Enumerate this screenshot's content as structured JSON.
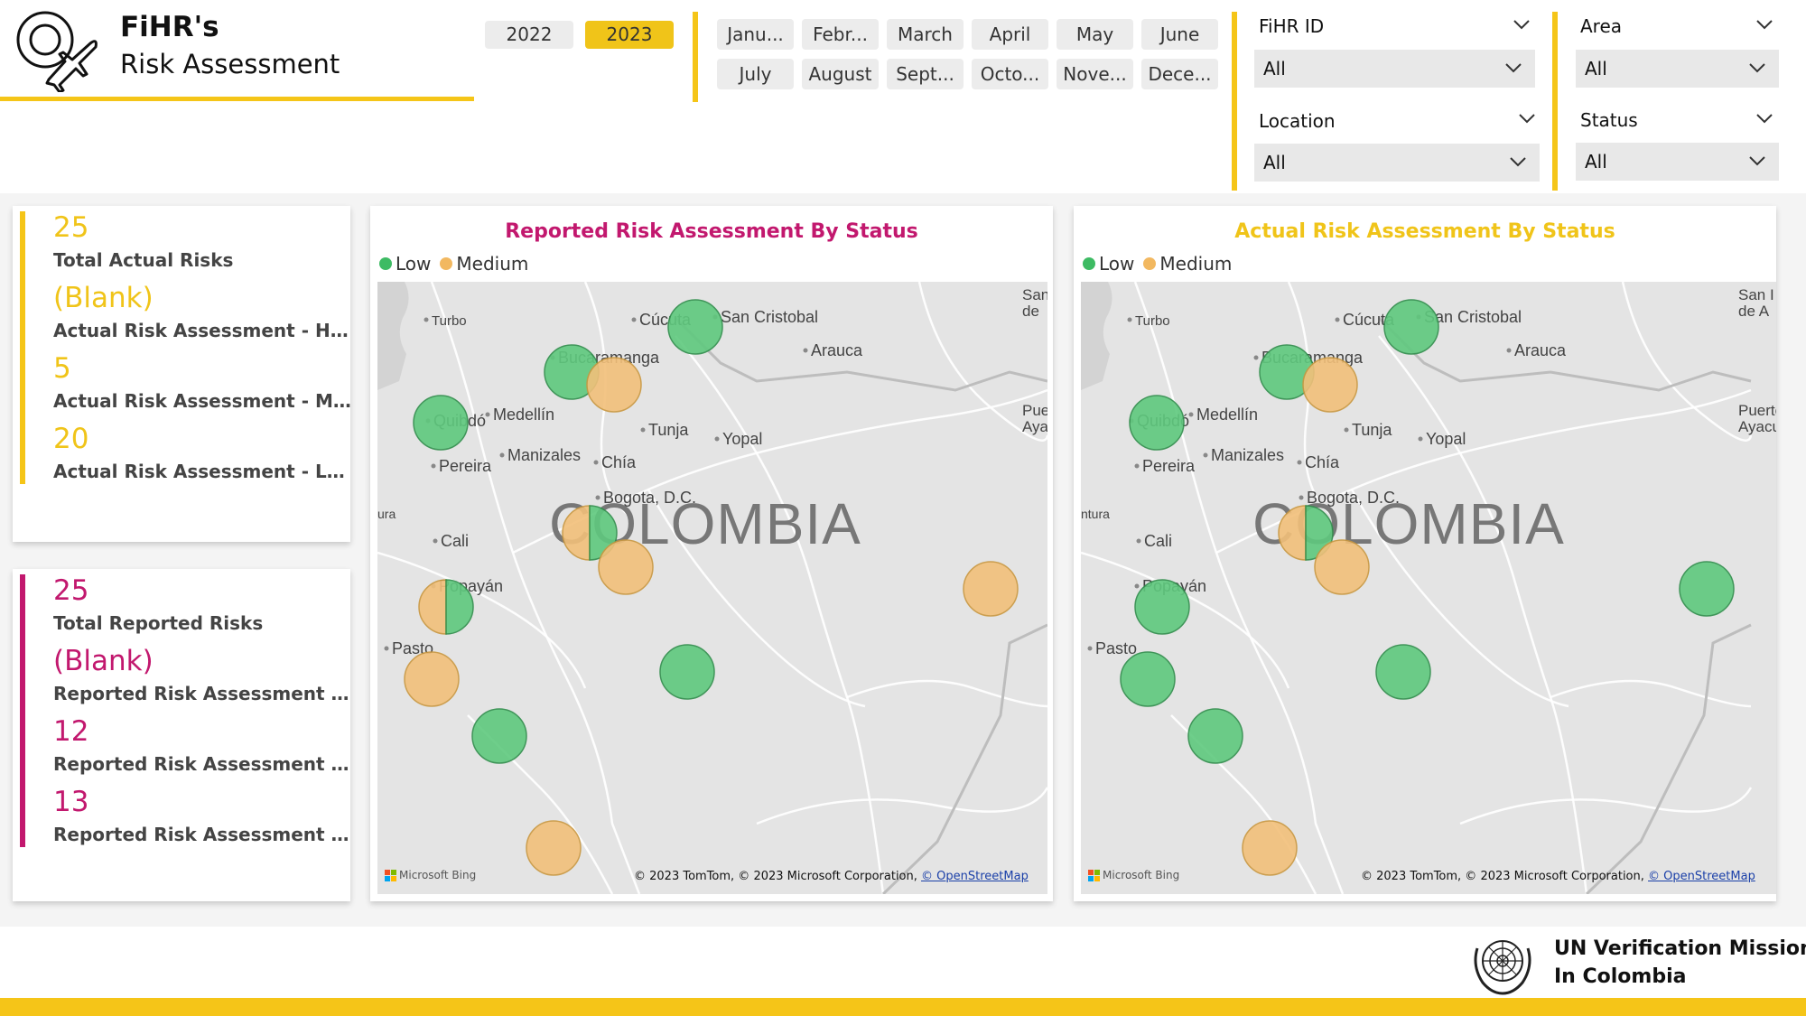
{
  "header": {
    "title_line1": "FiHR's",
    "title_line2": "Risk Assessment"
  },
  "years": [
    {
      "label": "2022",
      "selected": false
    },
    {
      "label": "2023",
      "selected": true
    }
  ],
  "months": [
    "Janu...",
    "Febr...",
    "March",
    "April",
    "May",
    "June",
    "July",
    "August",
    "Sept...",
    "Octo...",
    "Nove...",
    "Dece..."
  ],
  "filters": {
    "fihr_id": {
      "label": "FiHR ID",
      "value": "All"
    },
    "location": {
      "label": "Location",
      "value": "All"
    },
    "area": {
      "label": "Area",
      "value": "All"
    },
    "status": {
      "label": "Status",
      "value": "All"
    }
  },
  "actual_card": {
    "total_value": "25",
    "total_label": "Total Actual Risks",
    "high_value": "(Blank)",
    "high_label": "Actual Risk Assessment - High",
    "medium_value": "5",
    "medium_label": "Actual Risk Assessment - Medium",
    "low_value": "20",
    "low_label": "Actual Risk Assessment - Low"
  },
  "reported_card": {
    "total_value": "25",
    "total_label": "Total Reported Risks",
    "high_value": "(Blank)",
    "high_label": "Reported Risk Assessment - High",
    "medium_value": "12",
    "medium_label": "Reported Risk Assessment - Me...",
    "low_value": "13",
    "low_label": "Reported Risk Assessment - Low"
  },
  "maps": {
    "reported": {
      "title": "Reported Risk Assessment By Status",
      "title_color": "#c2186e",
      "legend_low": "Low",
      "legend_medium": "Medium"
    },
    "actual": {
      "title": "Actual Risk Assessment By Status",
      "title_color": "#f0c419",
      "legend_low": "Low",
      "legend_medium": "Medium"
    },
    "country_label": "COLOMBIA",
    "cities": [
      "Turbo",
      "Cúcuta",
      "San Cristobal",
      "Bucaramanga",
      "Arauca",
      "Medellín",
      "Quibdó",
      "Tunja",
      "Yopal",
      "Pereira",
      "Manizales",
      "Chía",
      "Bogota, D.C.",
      "Cali",
      "Popayán",
      "Pasto"
    ],
    "edge_labels_reported": [
      "San",
      "de",
      "Puer",
      "Ayac",
      "ura"
    ],
    "edge_labels_actual": [
      "San I",
      "de A",
      "Puerto",
      "Ayacu",
      "ntura"
    ],
    "bing_label": "Microsoft Bing",
    "attribution": "© 2023 TomTom, © 2023 Microsoft Corporation,",
    "attribution_link": "© OpenStreetMap"
  },
  "colors": {
    "accent_yellow": "#f5c518",
    "accent_magenta": "#c2186e",
    "low_green": "#3dbb63",
    "medium_orange": "#f2b860"
  },
  "footer": {
    "org_line1": "UN Verification Mission",
    "org_line2": "In Colombia"
  }
}
